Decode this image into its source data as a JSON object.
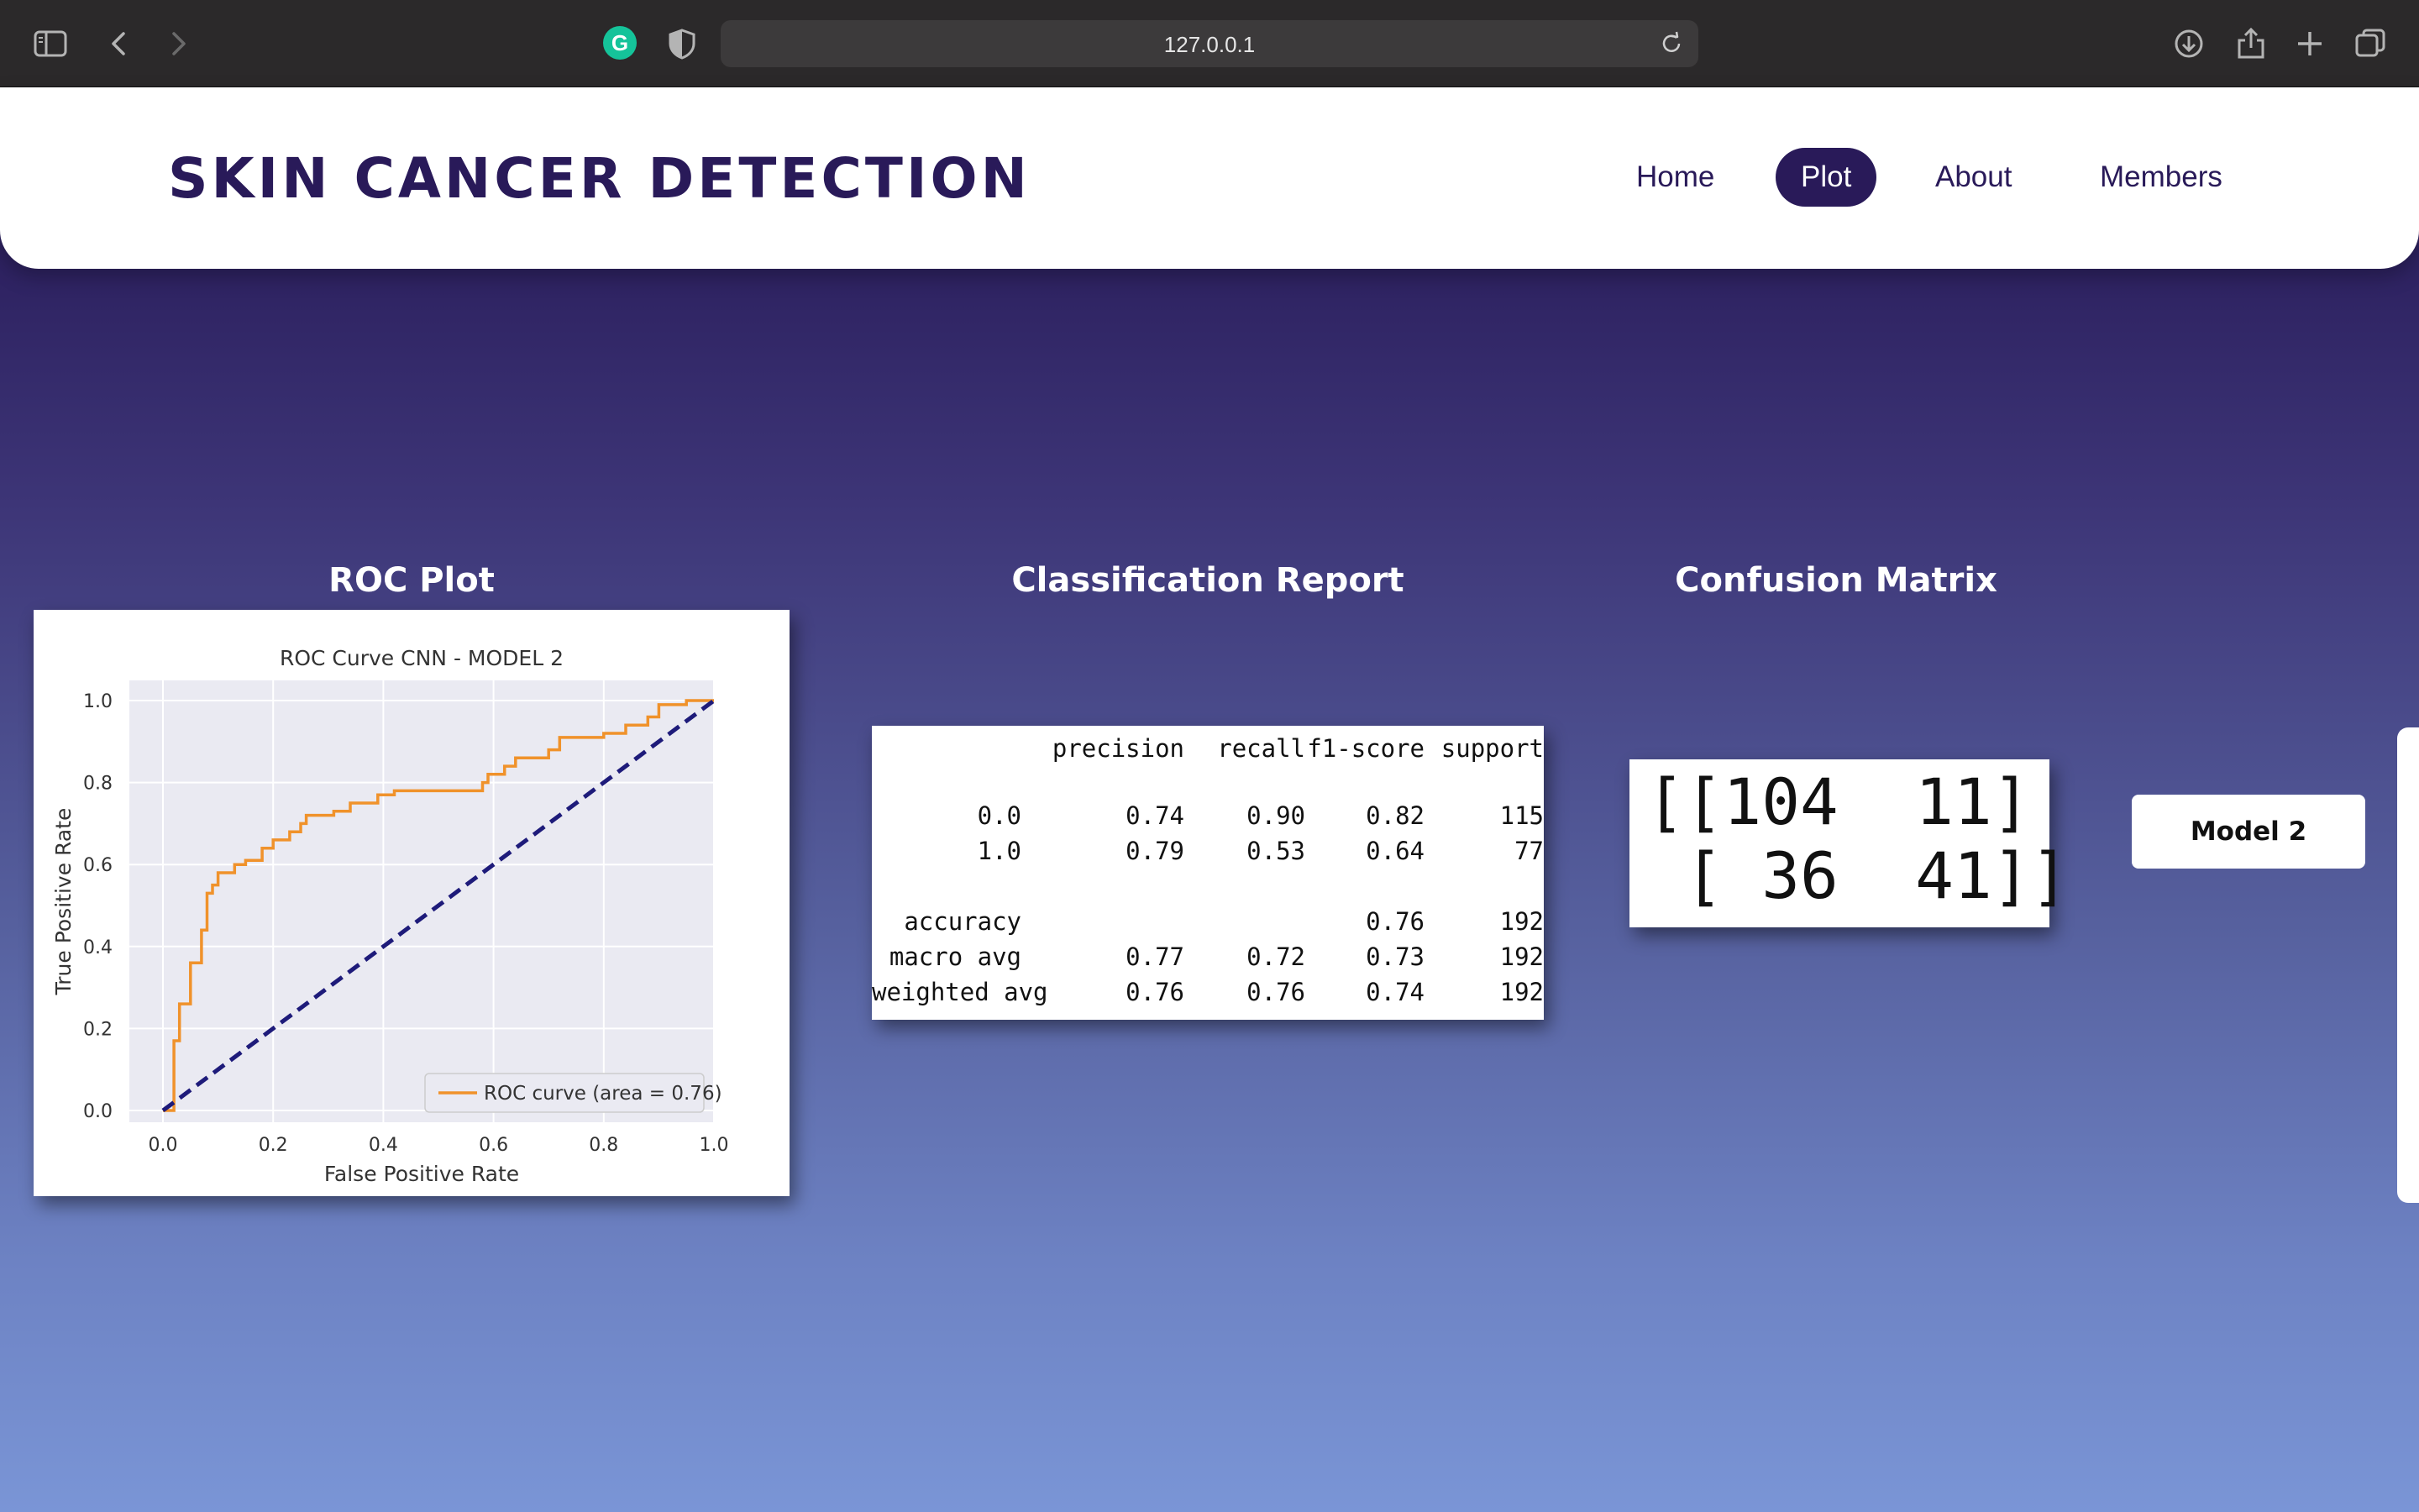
{
  "browser": {
    "url": "127.0.0.1",
    "icons": [
      "sidebar-icon",
      "back-icon",
      "forward-icon",
      "grammarly-icon",
      "shield-icon",
      "reload-icon",
      "download-icon",
      "share-icon",
      "new-tab-icon",
      "tabs-overview-icon"
    ],
    "grammarly_letter": "G"
  },
  "header": {
    "title": "SKIN CANCER DETECTION",
    "nav": [
      {
        "label": "Home",
        "active": false
      },
      {
        "label": "Plot",
        "active": true
      },
      {
        "label": "About",
        "active": false
      },
      {
        "label": "Members",
        "active": false
      }
    ],
    "accent_color": "#291a59"
  },
  "sections": {
    "roc_title": "ROC Plot",
    "report_title": "Classification Report",
    "matrix_title": "Confusion Matrix"
  },
  "chart_data": {
    "type": "line",
    "title": "ROC Curve CNN - MODEL 2",
    "xlabel": "False Positive Rate",
    "ylabel": "True Positive Rate",
    "xlim": [
      0.0,
      1.0
    ],
    "ylim": [
      0.0,
      1.0
    ],
    "xticks": [
      "0.0",
      "0.2",
      "0.4",
      "0.6",
      "0.8",
      "1.0"
    ],
    "yticks": [
      "0.0",
      "0.2",
      "0.4",
      "0.6",
      "0.8",
      "1.0"
    ],
    "grid": true,
    "legend_position": "lower-right",
    "series": [
      {
        "name": "ROC curve (area = 0.76)",
        "color": "#f0922b",
        "style": "solid",
        "x": [
          0.0,
          0.02,
          0.02,
          0.03,
          0.03,
          0.05,
          0.05,
          0.07,
          0.07,
          0.08,
          0.08,
          0.09,
          0.09,
          0.1,
          0.1,
          0.13,
          0.13,
          0.15,
          0.15,
          0.18,
          0.18,
          0.2,
          0.2,
          0.23,
          0.23,
          0.25,
          0.25,
          0.26,
          0.26,
          0.31,
          0.31,
          0.34,
          0.34,
          0.39,
          0.39,
          0.42,
          0.42,
          0.58,
          0.58,
          0.59,
          0.59,
          0.62,
          0.62,
          0.64,
          0.64,
          0.7,
          0.7,
          0.72,
          0.72,
          0.8,
          0.8,
          0.84,
          0.84,
          0.88,
          0.88,
          0.9,
          0.9,
          0.95,
          0.95,
          1.0
        ],
        "y": [
          0.0,
          0.0,
          0.17,
          0.17,
          0.26,
          0.26,
          0.36,
          0.36,
          0.44,
          0.44,
          0.53,
          0.53,
          0.55,
          0.55,
          0.58,
          0.58,
          0.6,
          0.6,
          0.61,
          0.61,
          0.64,
          0.64,
          0.66,
          0.66,
          0.68,
          0.68,
          0.7,
          0.7,
          0.72,
          0.72,
          0.73,
          0.73,
          0.75,
          0.75,
          0.77,
          0.77,
          0.78,
          0.78,
          0.8,
          0.8,
          0.82,
          0.82,
          0.84,
          0.84,
          0.86,
          0.86,
          0.88,
          0.88,
          0.91,
          0.91,
          0.92,
          0.92,
          0.94,
          0.94,
          0.96,
          0.96,
          0.99,
          0.99,
          1.0,
          1.0
        ]
      },
      {
        "name": "",
        "color": "#1e1b7a",
        "style": "dashed",
        "x": [
          0.0,
          1.0
        ],
        "y": [
          0.0,
          1.0
        ]
      }
    ]
  },
  "report": {
    "headers": [
      "precision",
      "recall",
      "f1-score",
      "support"
    ],
    "rows": [
      {
        "label": "0.0",
        "precision": "0.74",
        "recall": "0.90",
        "f1": "0.82",
        "support": "115"
      },
      {
        "label": "1.0",
        "precision": "0.79",
        "recall": "0.53",
        "f1": "0.64",
        "support": "77"
      },
      {
        "label": "accuracy",
        "precision": "",
        "recall": "",
        "f1": "0.76",
        "support": "192"
      },
      {
        "label": "macro avg",
        "precision": "0.77",
        "recall": "0.72",
        "f1": "0.73",
        "support": "192"
      },
      {
        "label": "weighted avg",
        "precision": "0.76",
        "recall": "0.76",
        "f1": "0.74",
        "support": "192"
      }
    ]
  },
  "matrix": {
    "line1": "[[104  11]",
    "line2": " [ 36  41]]"
  },
  "model_button": "Model 2"
}
